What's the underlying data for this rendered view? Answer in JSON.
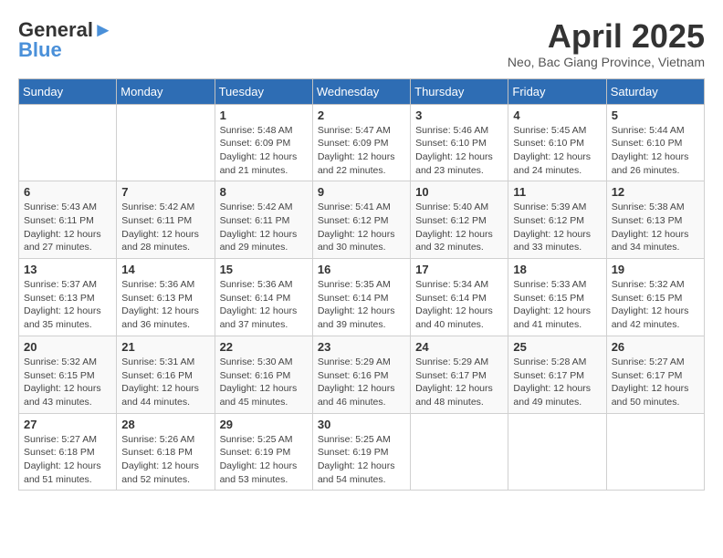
{
  "header": {
    "logo_line1": "General",
    "logo_line2": "Blue",
    "title": "April 2025",
    "subtitle": "Neo, Bac Giang Province, Vietnam"
  },
  "weekdays": [
    "Sunday",
    "Monday",
    "Tuesday",
    "Wednesday",
    "Thursday",
    "Friday",
    "Saturday"
  ],
  "weeks": [
    [
      {
        "day": "",
        "info": ""
      },
      {
        "day": "",
        "info": ""
      },
      {
        "day": "1",
        "info": "Sunrise: 5:48 AM\nSunset: 6:09 PM\nDaylight: 12 hours and 21 minutes."
      },
      {
        "day": "2",
        "info": "Sunrise: 5:47 AM\nSunset: 6:09 PM\nDaylight: 12 hours and 22 minutes."
      },
      {
        "day": "3",
        "info": "Sunrise: 5:46 AM\nSunset: 6:10 PM\nDaylight: 12 hours and 23 minutes."
      },
      {
        "day": "4",
        "info": "Sunrise: 5:45 AM\nSunset: 6:10 PM\nDaylight: 12 hours and 24 minutes."
      },
      {
        "day": "5",
        "info": "Sunrise: 5:44 AM\nSunset: 6:10 PM\nDaylight: 12 hours and 26 minutes."
      }
    ],
    [
      {
        "day": "6",
        "info": "Sunrise: 5:43 AM\nSunset: 6:11 PM\nDaylight: 12 hours and 27 minutes."
      },
      {
        "day": "7",
        "info": "Sunrise: 5:42 AM\nSunset: 6:11 PM\nDaylight: 12 hours and 28 minutes."
      },
      {
        "day": "8",
        "info": "Sunrise: 5:42 AM\nSunset: 6:11 PM\nDaylight: 12 hours and 29 minutes."
      },
      {
        "day": "9",
        "info": "Sunrise: 5:41 AM\nSunset: 6:12 PM\nDaylight: 12 hours and 30 minutes."
      },
      {
        "day": "10",
        "info": "Sunrise: 5:40 AM\nSunset: 6:12 PM\nDaylight: 12 hours and 32 minutes."
      },
      {
        "day": "11",
        "info": "Sunrise: 5:39 AM\nSunset: 6:12 PM\nDaylight: 12 hours and 33 minutes."
      },
      {
        "day": "12",
        "info": "Sunrise: 5:38 AM\nSunset: 6:13 PM\nDaylight: 12 hours and 34 minutes."
      }
    ],
    [
      {
        "day": "13",
        "info": "Sunrise: 5:37 AM\nSunset: 6:13 PM\nDaylight: 12 hours and 35 minutes."
      },
      {
        "day": "14",
        "info": "Sunrise: 5:36 AM\nSunset: 6:13 PM\nDaylight: 12 hours and 36 minutes."
      },
      {
        "day": "15",
        "info": "Sunrise: 5:36 AM\nSunset: 6:14 PM\nDaylight: 12 hours and 37 minutes."
      },
      {
        "day": "16",
        "info": "Sunrise: 5:35 AM\nSunset: 6:14 PM\nDaylight: 12 hours and 39 minutes."
      },
      {
        "day": "17",
        "info": "Sunrise: 5:34 AM\nSunset: 6:14 PM\nDaylight: 12 hours and 40 minutes."
      },
      {
        "day": "18",
        "info": "Sunrise: 5:33 AM\nSunset: 6:15 PM\nDaylight: 12 hours and 41 minutes."
      },
      {
        "day": "19",
        "info": "Sunrise: 5:32 AM\nSunset: 6:15 PM\nDaylight: 12 hours and 42 minutes."
      }
    ],
    [
      {
        "day": "20",
        "info": "Sunrise: 5:32 AM\nSunset: 6:15 PM\nDaylight: 12 hours and 43 minutes."
      },
      {
        "day": "21",
        "info": "Sunrise: 5:31 AM\nSunset: 6:16 PM\nDaylight: 12 hours and 44 minutes."
      },
      {
        "day": "22",
        "info": "Sunrise: 5:30 AM\nSunset: 6:16 PM\nDaylight: 12 hours and 45 minutes."
      },
      {
        "day": "23",
        "info": "Sunrise: 5:29 AM\nSunset: 6:16 PM\nDaylight: 12 hours and 46 minutes."
      },
      {
        "day": "24",
        "info": "Sunrise: 5:29 AM\nSunset: 6:17 PM\nDaylight: 12 hours and 48 minutes."
      },
      {
        "day": "25",
        "info": "Sunrise: 5:28 AM\nSunset: 6:17 PM\nDaylight: 12 hours and 49 minutes."
      },
      {
        "day": "26",
        "info": "Sunrise: 5:27 AM\nSunset: 6:17 PM\nDaylight: 12 hours and 50 minutes."
      }
    ],
    [
      {
        "day": "27",
        "info": "Sunrise: 5:27 AM\nSunset: 6:18 PM\nDaylight: 12 hours and 51 minutes."
      },
      {
        "day": "28",
        "info": "Sunrise: 5:26 AM\nSunset: 6:18 PM\nDaylight: 12 hours and 52 minutes."
      },
      {
        "day": "29",
        "info": "Sunrise: 5:25 AM\nSunset: 6:19 PM\nDaylight: 12 hours and 53 minutes."
      },
      {
        "day": "30",
        "info": "Sunrise: 5:25 AM\nSunset: 6:19 PM\nDaylight: 12 hours and 54 minutes."
      },
      {
        "day": "",
        "info": ""
      },
      {
        "day": "",
        "info": ""
      },
      {
        "day": "",
        "info": ""
      }
    ]
  ]
}
